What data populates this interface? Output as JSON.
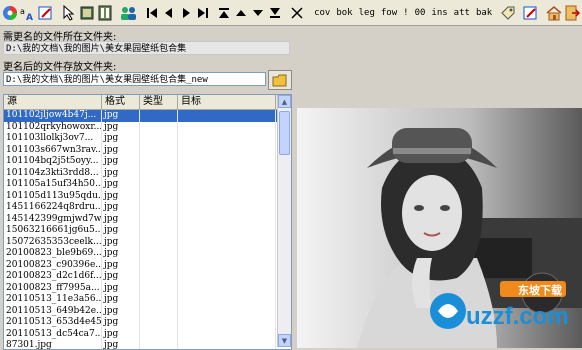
{
  "toolbar": {
    "text_buttons": [
      "cov",
      "bok",
      "leg",
      "fow",
      "!",
      "00",
      "ins",
      "att",
      "bak"
    ]
  },
  "labels": {
    "source_folder": "需更名的文件所在文件夹:",
    "target_folder": "更名后的文件存放文件夹:"
  },
  "paths": {
    "source": "D:\\我的文档\\我的图片\\美女果园壁纸包合集",
    "target": "D:\\我的文档\\我的图片\\美女果园壁纸包合集_new"
  },
  "list": {
    "columns": [
      "源",
      "格式",
      "类型",
      "目标"
    ],
    "rows": [
      {
        "src": "101102jljow4b47j...",
        "fmt": "jpg"
      },
      {
        "src": "101102qrkyhowoxr...",
        "fmt": "jpg"
      },
      {
        "src": "101103llolkj3ov7...",
        "fmt": "jpg"
      },
      {
        "src": "101103s667wn3rav...",
        "fmt": "jpg"
      },
      {
        "src": "101104bq2j5t5oyy...",
        "fmt": "jpg"
      },
      {
        "src": "101104z3kti3rdd8...",
        "fmt": "jpg"
      },
      {
        "src": "101105a15uf34h50...",
        "fmt": "jpg"
      },
      {
        "src": "101105d113u95qdu...",
        "fmt": "jpg"
      },
      {
        "src": "1451166224q8rdru...",
        "fmt": "jpg"
      },
      {
        "src": "145142399gmjwd7w...",
        "fmt": "jpg"
      },
      {
        "src": "15063216661jg6u5...",
        "fmt": "jpg"
      },
      {
        "src": "15072635353ceelk...",
        "fmt": "jpg"
      },
      {
        "src": "20100823_ble9b69...",
        "fmt": "jpg"
      },
      {
        "src": "20100823_c90396e...",
        "fmt": "jpg"
      },
      {
        "src": "20100823_d2c1d6f...",
        "fmt": "jpg"
      },
      {
        "src": "20100823_ff7995a...",
        "fmt": "jpg"
      },
      {
        "src": "20110513_11e3a56...",
        "fmt": "jpg"
      },
      {
        "src": "20110513_649b42e...",
        "fmt": "jpg"
      },
      {
        "src": "20110513_653d4e45...",
        "fmt": "jpg"
      },
      {
        "src": "20110513_dc54ca7...",
        "fmt": "jpg"
      },
      {
        "src": "87301.jpg",
        "fmt": "jpg"
      },
      {
        "src": "Meinv321#com_No...",
        "fmt": "jpg"
      }
    ]
  },
  "watermark": {
    "brand": "uzzf.com",
    "tagline": "东坡下载"
  }
}
